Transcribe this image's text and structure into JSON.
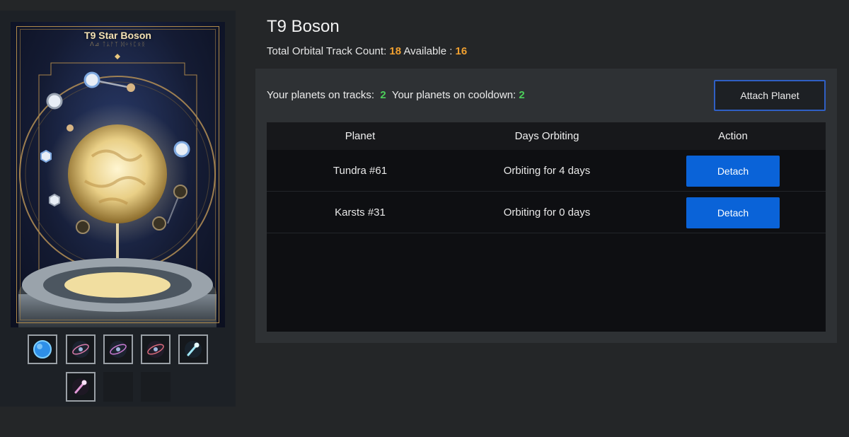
{
  "card": {
    "title": "T9 Star Boson",
    "subtitle": "ᐱ⊿ ᛏᛦᚨᛉ ᛞᛜᚾᛈᛟᛝ"
  },
  "thumbnails": [
    {
      "icon": "blue-planet-icon",
      "empty": false
    },
    {
      "icon": "nebula-ring-icon",
      "empty": false
    },
    {
      "icon": "nebula-ring-icon",
      "empty": false
    },
    {
      "icon": "nebula-ring-icon",
      "empty": false
    },
    {
      "icon": "comet-icon",
      "empty": false
    },
    {
      "icon": "pink-comet-icon",
      "empty": false
    },
    {
      "icon": "",
      "empty": true
    },
    {
      "icon": "",
      "empty": true
    }
  ],
  "header": {
    "title": "T9 Boson",
    "track_label": "Total Orbital Track Count:",
    "track_count": "18",
    "available_label": "Available :",
    "available_count": "16"
  },
  "status": {
    "on_tracks_label": "Your planets on tracks:",
    "on_tracks_count": "2",
    "cooldown_label": "Your planets on cooldown:",
    "cooldown_count": "2",
    "attach_label": "Attach Planet"
  },
  "table": {
    "headers": [
      "Planet",
      "Days Orbiting",
      "Action"
    ],
    "rows": [
      {
        "planet": "Tundra #61",
        "days": "Orbiting for 4 days",
        "action": "Detach"
      },
      {
        "planet": "Karsts #31",
        "days": "Orbiting for 0 days",
        "action": "Detach"
      }
    ]
  },
  "colors": {
    "accent_orange": "#f0a030",
    "accent_green": "#4ccf5a",
    "button_blue": "#0a63d8",
    "attach_border": "#2f5fc4"
  }
}
